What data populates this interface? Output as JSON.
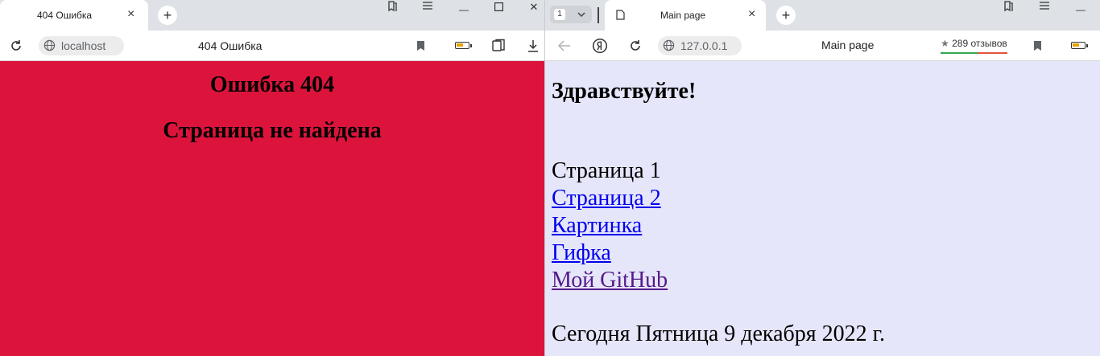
{
  "left": {
    "tab": {
      "label": "404 Ошибка"
    },
    "address": {
      "host": "localhost",
      "page_title": "404 Ошибка"
    },
    "page": {
      "heading": "Ошибка 404",
      "subheading": "Страница не найдена",
      "background": "#dc143c"
    }
  },
  "right": {
    "tab_counter": "1",
    "tab": {
      "label": "Main page"
    },
    "address": {
      "host": "127.0.0.1",
      "page_title": "Main page",
      "reviews": "289 отзывов"
    },
    "page": {
      "background": "#e6e6fa",
      "greeting": "Здравствуйте!",
      "current_page": "Страница 1",
      "links": [
        "Страница 2",
        "Картинка",
        "Гифка",
        "Мой GitHub"
      ],
      "date_line": "Сегодня Пятница 9 декабря 2022 г."
    }
  },
  "icons": {
    "tab_close": "×",
    "new_tab": "+",
    "star": "★",
    "minimize": "—",
    "maximize": "☐",
    "window_close": "✕"
  }
}
